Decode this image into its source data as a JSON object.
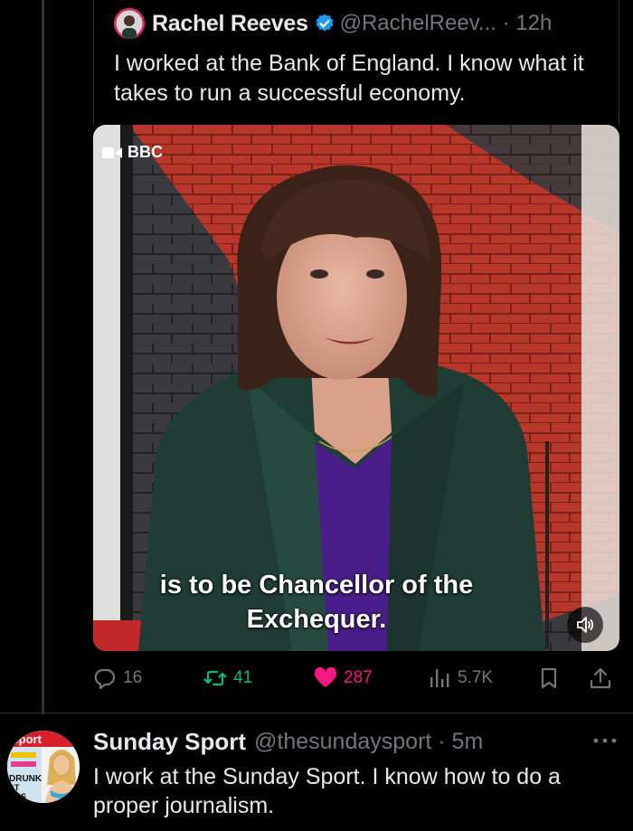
{
  "quoted_tweet": {
    "author_name": "Rachel Reeves",
    "verified_icon": "verified-badge-icon",
    "handle_and_time": "@RachelReev... · 12h",
    "text": "I worked at the Bank of England. I know what it takes to run a successful economy."
  },
  "video": {
    "source_tag": "BBC",
    "caption_line_1": "is to be Chancellor of the",
    "caption_line_2": "Exchequer.",
    "mute_icon": "speaker-muted-icon"
  },
  "actions": {
    "replies": "16",
    "retweets": "41",
    "likes": "287",
    "views": "5.7K",
    "icons": [
      "reply-icon",
      "retweet-icon",
      "heart-icon",
      "views-icon",
      "bookmark-icon",
      "share-icon"
    ]
  },
  "reply_tweet": {
    "author_name": "Sunday Sport",
    "handle_and_time": "@thesundaysport · 5m",
    "text": "I work at the Sunday Sport. I know how to do a proper journalism.",
    "avatar_words": [
      "Sport",
      "DRUNK",
      "AT",
      "RNS"
    ]
  },
  "colors": {
    "background": "#000000",
    "text": "#e7e9ea",
    "muted": "#71767b",
    "retweet_green": "#00ba7c",
    "like_pink": "#f91880",
    "verified_blue": "#1d9bf0"
  }
}
